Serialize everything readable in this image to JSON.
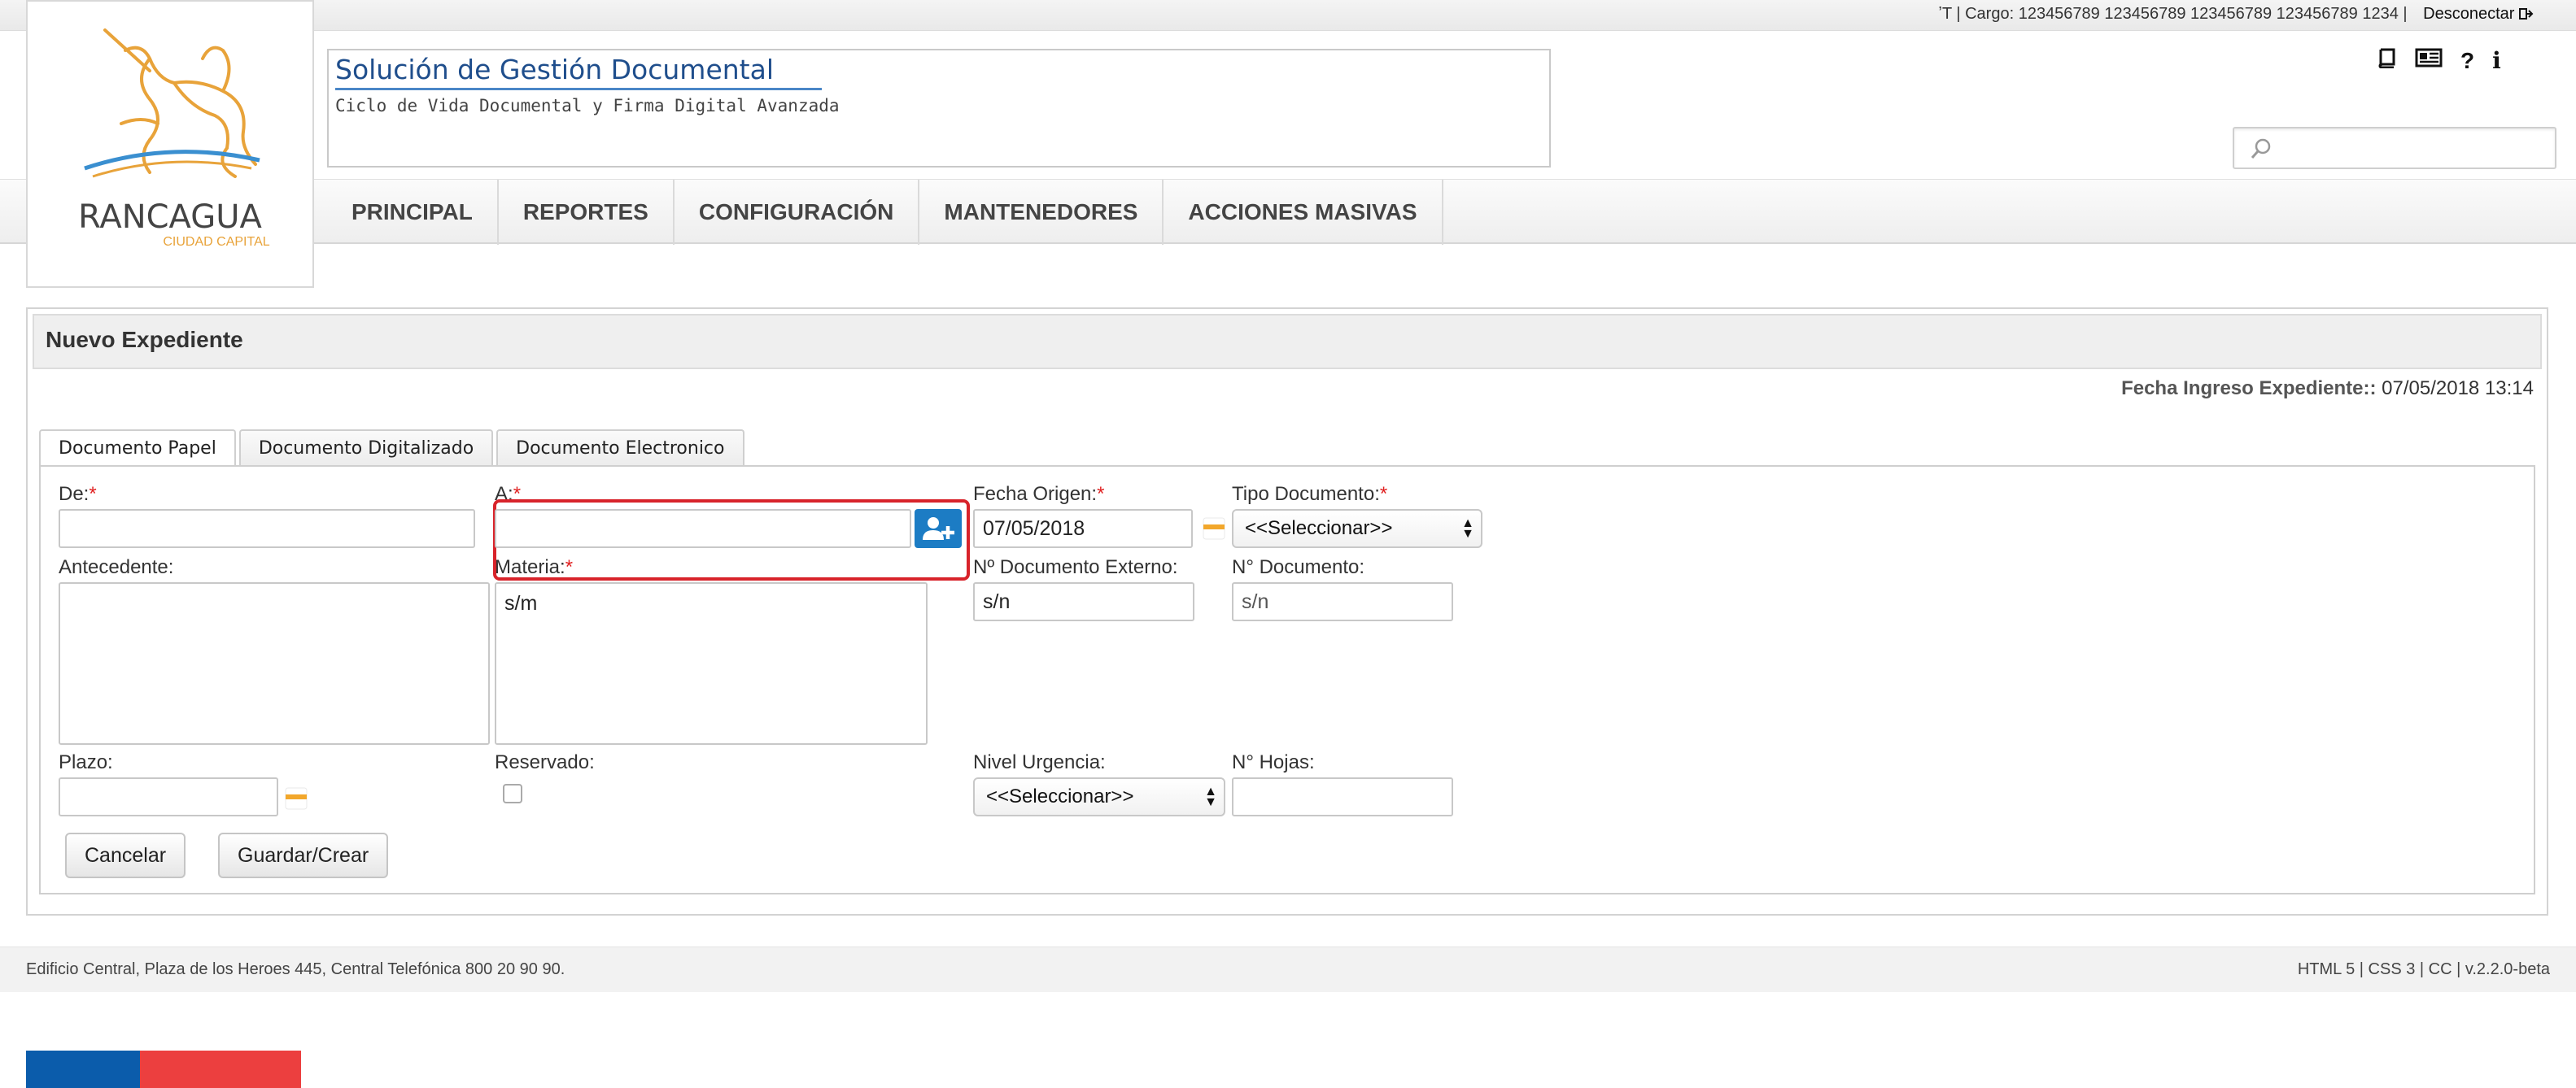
{
  "topbar": {
    "user_info": "ʼT | Cargo: 123456789 123456789 123456789 123456789 1234 |",
    "logout_label": "Desconectar"
  },
  "logo": {
    "name": "RANCAGUA",
    "tagline": "CIUDAD CAPITAL"
  },
  "brand": {
    "title": "Solución de Gestión Documental",
    "subtitle": "Ciclo de Vida Documental y Firma Digital Avanzada"
  },
  "tools": {
    "help_label": "?",
    "info_label": "i"
  },
  "search": {
    "placeholder": ""
  },
  "menu": {
    "items": [
      "PRINCIPAL",
      "REPORTES",
      "CONFIGURACIÓN",
      "MANTENEDORES",
      "ACCIONES MASIVAS"
    ]
  },
  "panel": {
    "title": "Nuevo Expediente",
    "fecha_ingreso_label": "Fecha Ingreso Expediente::",
    "fecha_ingreso_value": "07/05/2018 13:14"
  },
  "tabs": [
    "Documento Papel",
    "Documento Digitalizado",
    "Documento Electronico"
  ],
  "form": {
    "required_mark": "*",
    "de": {
      "label": "De:",
      "value": ""
    },
    "a": {
      "label": "A:",
      "value": ""
    },
    "fecha_origen": {
      "label": "Fecha Origen:",
      "value": "07/05/2018"
    },
    "tipo_documento": {
      "label": "Tipo Documento:",
      "selected": "<<Seleccionar>>"
    },
    "antecedente": {
      "label": "Antecedente:",
      "value": ""
    },
    "materia": {
      "label": "Materia:",
      "value": "s/m"
    },
    "nro_doc_externo": {
      "label": "Nº Documento Externo:",
      "value": "s/n"
    },
    "nro_documento": {
      "label": "N° Documento:",
      "value": "s/n"
    },
    "plazo": {
      "label": "Plazo:",
      "value": ""
    },
    "reservado": {
      "label": "Reservado:",
      "checked": false
    },
    "nivel_urgencia": {
      "label": "Nivel Urgencia:",
      "selected": "<<Seleccionar>>"
    },
    "nro_hojas": {
      "label": "N° Hojas:",
      "value": ""
    }
  },
  "buttons": {
    "cancel": "Cancelar",
    "save": "Guardar/Crear"
  },
  "footer": {
    "address": "Edificio Central, Plaza de los Heroes 445, Central Telefónica 800 20 90 90.",
    "credits": "HTML 5 | CSS 3 | CC | v.2.2.0-beta"
  },
  "colors": {
    "accent_blue": "#1c7cc4",
    "brand_blue": "#1f4e8c",
    "required_red": "#e02020",
    "highlight_red": "#d8232a",
    "calendar_orange": "#f2a72b",
    "flag_blue": "#0b5cab",
    "flag_red": "#ec3f3f"
  }
}
